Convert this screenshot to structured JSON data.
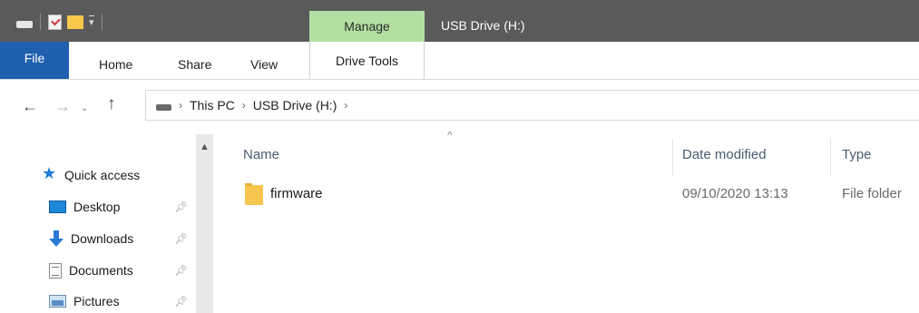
{
  "titlebar": {
    "manage_label": "Manage",
    "window_title": "USB Drive (H:)",
    "qat_icons": [
      "drive-icon",
      "properties-icon",
      "new-folder-icon",
      "customize-dropdown-icon"
    ]
  },
  "ribbon": {
    "tabs": [
      "File",
      "Home",
      "Share",
      "View"
    ],
    "contextual_tab": "Drive Tools",
    "file_tab_color": "#1e5fae",
    "manage_color": "#b3e0a2"
  },
  "nav_buttons": {
    "back": "←",
    "forward": "→",
    "recent": "⌄",
    "up": "↑"
  },
  "address": {
    "separator": "›",
    "crumbs": [
      "This PC",
      "USB Drive (H:)"
    ]
  },
  "sidebar": {
    "items": [
      {
        "label": "Quick access",
        "icon": "star-icon",
        "pinned": false
      },
      {
        "label": "Desktop",
        "icon": "desktop-icon",
        "pinned": true
      },
      {
        "label": "Downloads",
        "icon": "downloads-icon",
        "pinned": true
      },
      {
        "label": "Documents",
        "icon": "documents-icon",
        "pinned": true
      },
      {
        "label": "Pictures",
        "icon": "pictures-icon",
        "pinned": true
      }
    ]
  },
  "filelist": {
    "columns": [
      "Name",
      "Date modified",
      "Type"
    ],
    "rows": [
      {
        "name": "firmware",
        "date": "09/10/2020 13:13",
        "type": "File folder"
      }
    ]
  }
}
